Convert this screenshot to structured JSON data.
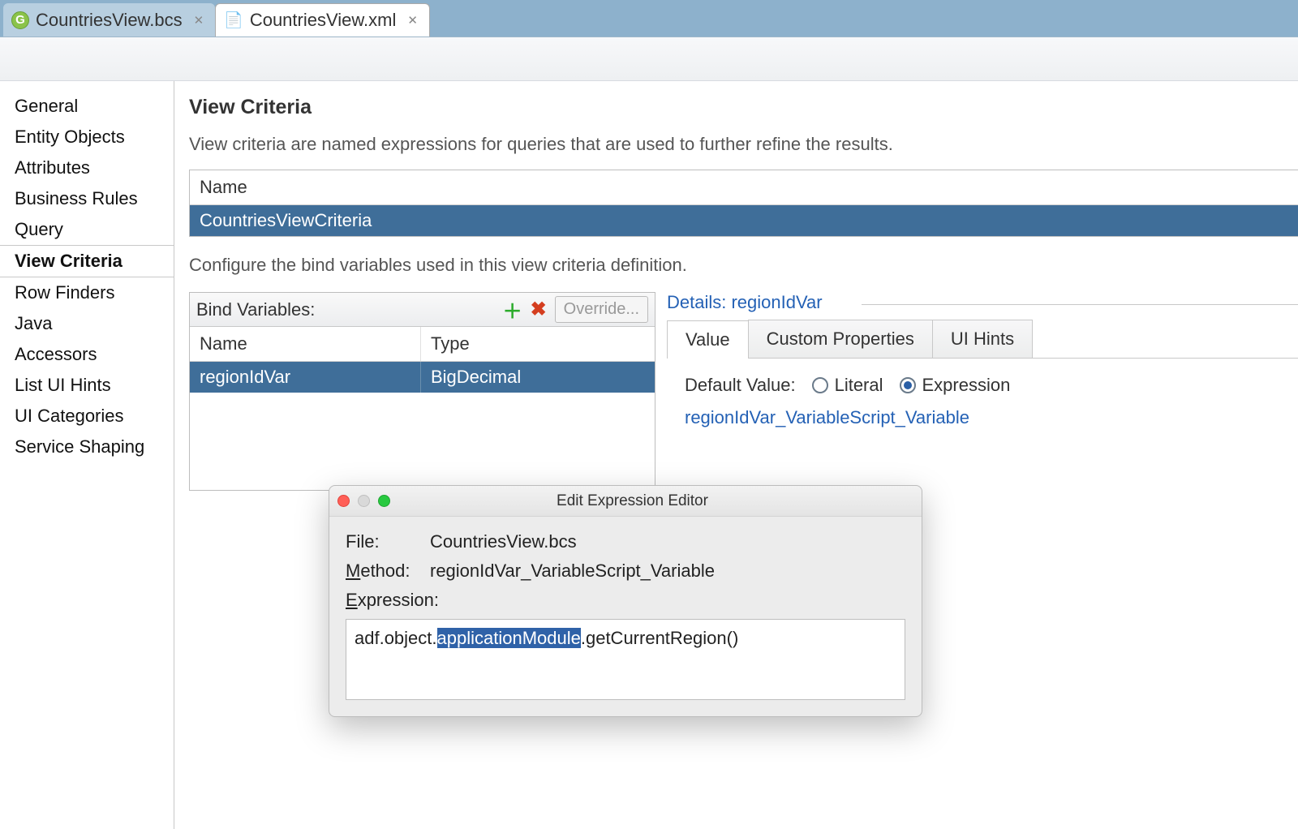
{
  "tabs": {
    "items": [
      {
        "label": "CountriesView.bcs",
        "active": false
      },
      {
        "label": "CountriesView.xml",
        "active": true
      }
    ]
  },
  "sidebar": {
    "items": [
      "General",
      "Entity Objects",
      "Attributes",
      "Business Rules",
      "Query",
      "View Criteria",
      "Row Finders",
      "Java",
      "Accessors",
      "List UI Hints",
      "UI Categories",
      "Service Shaping"
    ],
    "selectedIndex": 5
  },
  "main": {
    "section_title": "View Criteria",
    "section_desc": "View criteria are named expressions for queries that are used to further refine the results.",
    "name_table": {
      "header": "Name",
      "row": "CountriesViewCriteria"
    },
    "bind_desc": "Configure the bind variables used in this view criteria definition.",
    "bind": {
      "title": "Bind Variables:",
      "override_label": "Override...",
      "cols": {
        "c1": "Name",
        "c2": "Type"
      },
      "row": {
        "c1": "regionIdVar",
        "c2": "BigDecimal"
      }
    },
    "details": {
      "legend_prefix": "Details: ",
      "legend_var": "regionIdVar",
      "tabs": [
        "Value",
        "Custom Properties",
        "UI Hints"
      ],
      "active_tab": 0,
      "default_value_label": "Default Value:",
      "radio_literal": "Literal",
      "radio_expression": "Expression",
      "script_link": "regionIdVar_VariableScript_Variable"
    }
  },
  "dialog": {
    "title": "Edit Expression Editor",
    "file_label": "File:",
    "file_value": "CountriesView.bcs",
    "method_label_pre": "M",
    "method_label_post": "ethod:",
    "method_value": "regionIdVar_VariableScript_Variable",
    "expr_label_pre": "E",
    "expr_label_post": "xpression:",
    "expr_before": "adf.object.",
    "expr_hl": "applicationModule",
    "expr_after": ".getCurrentRegion()"
  }
}
